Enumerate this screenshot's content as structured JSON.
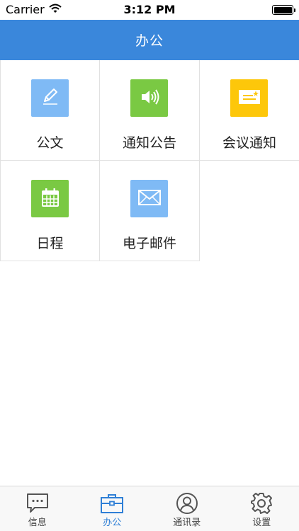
{
  "status_bar": {
    "carrier": "Carrier",
    "time": "3:12 PM"
  },
  "nav": {
    "title": "办公"
  },
  "grid": {
    "items": [
      {
        "label": "公文",
        "icon": "document-edit-icon",
        "color": "#7fbaf5"
      },
      {
        "label": "通知公告",
        "icon": "speaker-icon",
        "color": "#7ac943"
      },
      {
        "label": "会议通知",
        "icon": "meeting-card-icon",
        "color": "#fdc70a"
      },
      {
        "label": "日程",
        "icon": "calendar-icon",
        "color": "#7ac943"
      },
      {
        "label": "电子邮件",
        "icon": "mail-icon",
        "color": "#7fbaf5"
      }
    ]
  },
  "tab_bar": {
    "items": [
      {
        "label": "信息",
        "icon": "message-icon"
      },
      {
        "label": "办公",
        "icon": "briefcase-icon",
        "active": true
      },
      {
        "label": "通讯录",
        "icon": "contacts-icon"
      },
      {
        "label": "设置",
        "icon": "gear-icon"
      }
    ],
    "active_color": "#2f7fd6"
  }
}
